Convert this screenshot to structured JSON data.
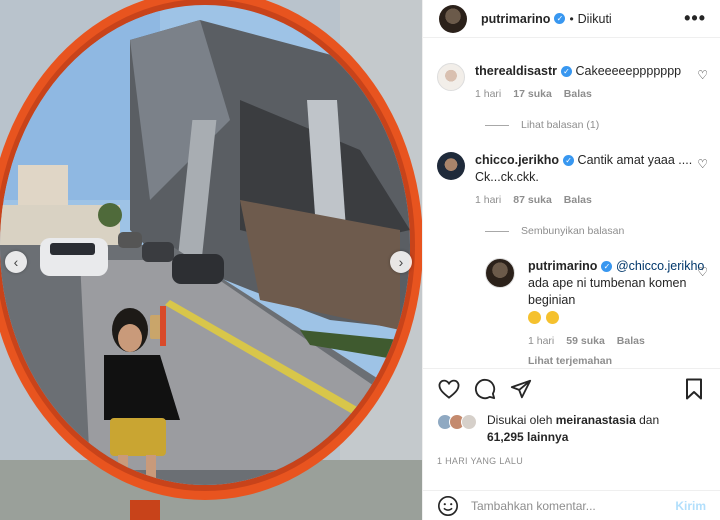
{
  "post": {
    "photo_alt": "photo",
    "nav": {
      "prev_icon": "chevron-left-icon",
      "next_icon": "chevron-right-icon"
    }
  },
  "header": {
    "username": "putrimarino",
    "separator": "•",
    "follow_status": "Diikuti",
    "more": "•••"
  },
  "comments": [
    {
      "username": "therealdisastr",
      "text": "Cakeeeeeppppppp",
      "age": "1 hari",
      "likes": "17 suka",
      "reply": "Balas"
    },
    {
      "username": "chicco.jerikho",
      "text": "Cantik amat yaaa .... Ck...ck.ckk.",
      "age": "1 hari",
      "likes": "87 suka",
      "reply": "Balas"
    }
  ],
  "threads": {
    "view_replies": "Lihat balasan (1)",
    "hide_replies": "Sembunyikan balasan"
  },
  "reply": {
    "username": "putrimarino",
    "mention": "@chicco.jerikho",
    "text": " ada ape ni tumbenan komen beginian",
    "age": "1 hari",
    "likes": "59 suka",
    "reply": "Balas",
    "translate": "Lihat terjemahan"
  },
  "likes": {
    "prefix": "Disukai oleh",
    "user": "meiranastasia",
    "and": "dan",
    "count": "61,295 lainnya"
  },
  "date": "1 HARI YANG LALU",
  "add_comment": {
    "placeholder": "Tambahkan komentar...",
    "post_label": "Kirim"
  },
  "colors": {
    "verified": "#3897f0",
    "mirror_frame": "#e8541f",
    "link": "#00376b"
  }
}
